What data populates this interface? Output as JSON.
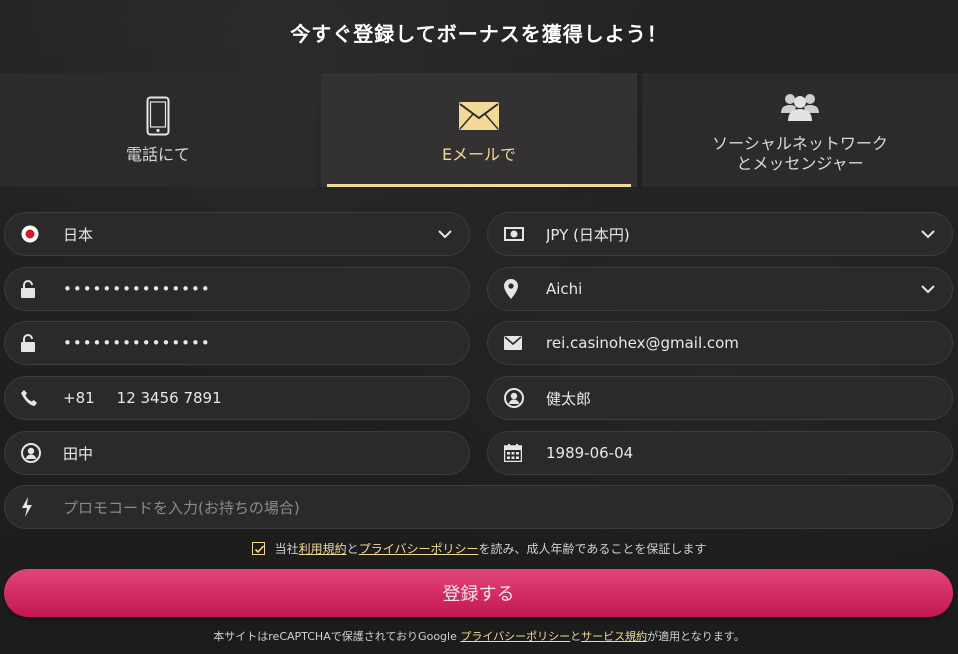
{
  "header": {
    "title": "今すぐ登録してボーナスを獲得しよう！"
  },
  "tabs": [
    {
      "label": "電話にて",
      "icon": "phone-icon"
    },
    {
      "label": "Eメールで",
      "icon": "envelope-icon",
      "active": true
    },
    {
      "label_line1": "ソーシャルネットワーク",
      "label_line2": "とメッセンジャー",
      "icon": "users-icon"
    }
  ],
  "form": {
    "country": {
      "value": "日本",
      "icon": "japan-flag-icon"
    },
    "currency": {
      "value": "JPY (日本円)",
      "icon": "banknote-icon"
    },
    "password": {
      "value": "•••••••••••••••",
      "icon": "unlock-icon"
    },
    "region": {
      "value": "Aichi",
      "icon": "map-pin-icon"
    },
    "password_confirm": {
      "value": "•••••••••••••••",
      "icon": "unlock-icon"
    },
    "email": {
      "value": "rei.casinohex@gmail.com",
      "icon": "envelope-icon"
    },
    "phone": {
      "code": "+81",
      "number": "12 3456 7891",
      "icon": "phone-icon"
    },
    "first_name": {
      "value": "健太郎",
      "icon": "user-circle-icon"
    },
    "last_name": {
      "value": "田中",
      "icon": "user-circle-icon"
    },
    "birthdate": {
      "value": "1989-06-04",
      "icon": "calendar-icon"
    },
    "promo": {
      "placeholder": "プロモコードを入力(お持ちの場合)",
      "icon": "lightning-icon"
    }
  },
  "agreement": {
    "prefix": "当社",
    "terms_link": "利用規約",
    "and": "と",
    "privacy_link": "プライバシーポリシー",
    "suffix": "を読み、成人年齢であることを保証します",
    "checked": true
  },
  "submit": {
    "label": "登録する"
  },
  "recaptcha": {
    "prefix": "本サイトはreCAPTCHAで保護されておりGoogle ",
    "privacy_link": "プライバシーポリシー",
    "and": "と",
    "terms_link": "サービス規約",
    "suffix": "が適用となります。"
  },
  "colors": {
    "accent": "#f2d995",
    "button": "#d62a62",
    "field_bg": "#2a2a2a",
    "bg": "#1f1f1f"
  }
}
